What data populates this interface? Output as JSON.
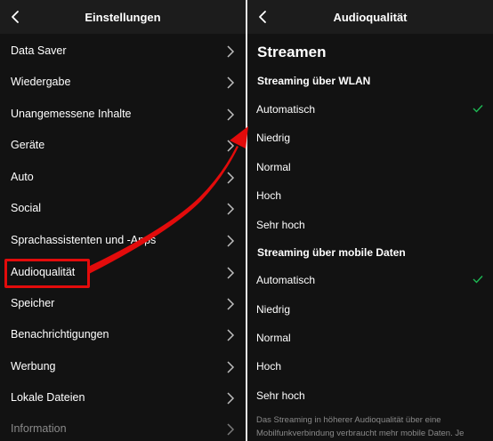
{
  "left": {
    "header": {
      "title": "Einstellungen",
      "back_icon": "chevron-left-icon"
    },
    "items": [
      {
        "label": "Data Saver"
      },
      {
        "label": "Wiedergabe"
      },
      {
        "label": "Unangemessene Inhalte"
      },
      {
        "label": "Geräte"
      },
      {
        "label": "Auto"
      },
      {
        "label": "Social"
      },
      {
        "label": "Sprachassistenten und -Apps"
      },
      {
        "label": "Audioqualität"
      },
      {
        "label": "Speicher"
      },
      {
        "label": "Benachrichtigungen"
      },
      {
        "label": "Werbung"
      },
      {
        "label": "Lokale Dateien"
      },
      {
        "label": "Information"
      }
    ],
    "highlighted_item": "Audioqualität"
  },
  "right": {
    "header": {
      "title": "Audioqualität",
      "back_icon": "chevron-left-icon"
    },
    "heading": "Streamen",
    "wlan": {
      "title": "Streaming über WLAN",
      "options": [
        "Automatisch",
        "Niedrig",
        "Normal",
        "Hoch",
        "Sehr hoch"
      ],
      "selected": "Automatisch"
    },
    "mobile": {
      "title": "Streaming über mobile Daten",
      "options": [
        "Automatisch",
        "Niedrig",
        "Normal",
        "Hoch",
        "Sehr hoch"
      ],
      "selected": "Automatisch"
    },
    "footnote": "Das Streaming in höherer Audioqualität über eine Mobilfunkverbindung verbraucht mehr mobile Daten. Je"
  },
  "colors": {
    "background": "#121212",
    "header": "#1c1c1c",
    "check": "#1db954",
    "annotation": "#e30b0b"
  }
}
